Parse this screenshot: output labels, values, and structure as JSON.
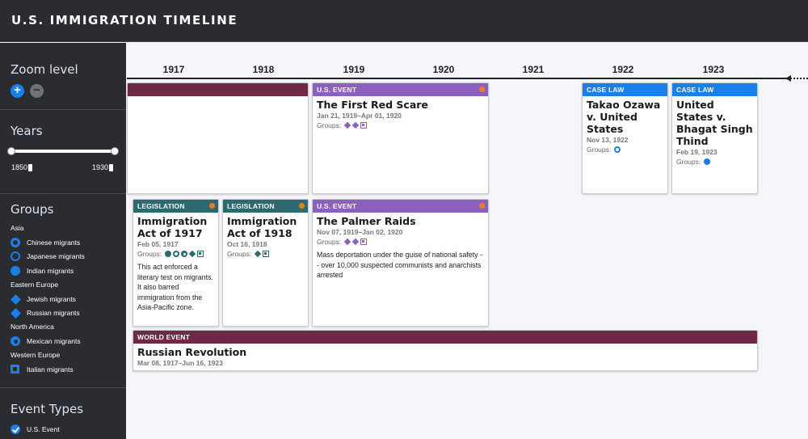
{
  "header": {
    "title": "U.S. IMMIGRATION TIMELINE"
  },
  "sidebar": {
    "zoom": {
      "title": "Zoom level",
      "zoom_in": "+",
      "zoom_out": "−"
    },
    "years": {
      "title": "Years",
      "min": "1850",
      "max": "1930"
    },
    "groups": {
      "title": "Groups",
      "regions": [
        {
          "name": "Asia",
          "items": [
            "Chinese migrants",
            "Japanese migrants",
            "Indian migrants"
          ]
        },
        {
          "name": "Eastern Europe",
          "items": [
            "Jewish migrants",
            "Russian migrants"
          ]
        },
        {
          "name": "North America",
          "items": [
            "Mexican migrants"
          ]
        },
        {
          "name": "Western Europe",
          "items": [
            "Italian migrants"
          ]
        }
      ]
    },
    "event_types": {
      "title": "Event Types",
      "items": [
        "U.S. Event"
      ]
    }
  },
  "timeline": {
    "years": [
      "1917",
      "1918",
      "1919",
      "1920",
      "1921",
      "1922",
      "1923"
    ]
  },
  "cards": {
    "red_scare": {
      "type": "U.S. EVENT",
      "title": "The First Red Scare",
      "date": "Jan 21, 1919–Apr 01, 1920",
      "groups_label": "Groups:"
    },
    "ozawa": {
      "type": "CASE LAW",
      "title": "Takao Ozawa v. United States",
      "date": "Nov 13, 1922",
      "groups_label": "Groups:"
    },
    "thind": {
      "type": "CASE LAW",
      "title": "United States v. Bhagat Singh Thind",
      "date": "Feb 19, 1923",
      "groups_label": "Groups:"
    },
    "act1917": {
      "type": "LEGISLATION",
      "title": "Immigration Act of 1917",
      "date": "Feb 05, 1917",
      "groups_label": "Groups:",
      "description": "This act enforced a literary test on migrants. It also barred immigration from the Asia-Pacific zone."
    },
    "act1918": {
      "type": "LEGISLATION",
      "title": "Immigration Act of 1918",
      "date": "Oct 16, 1918",
      "groups_label": "Groups:"
    },
    "palmer": {
      "type": "U.S. EVENT",
      "title": "The Palmer Raids",
      "date": "Nov 07, 1919–Jan 02, 1920",
      "groups_label": "Groups:",
      "description": "Mass deportation under the guise of national safety -- over 10,000 suspected communists and anarchists arrested"
    },
    "russian": {
      "type": "WORLD EVENT",
      "title": "Russian Revolution",
      "date": "Mar 08, 1917–Jun 16, 1923"
    }
  },
  "colors": {
    "us_event": "#8c60c0",
    "legislation": "#2c6a70",
    "world_event": "#6f2846",
    "case_law": "#1a7fe8",
    "status_dot": "#f07a1a"
  }
}
